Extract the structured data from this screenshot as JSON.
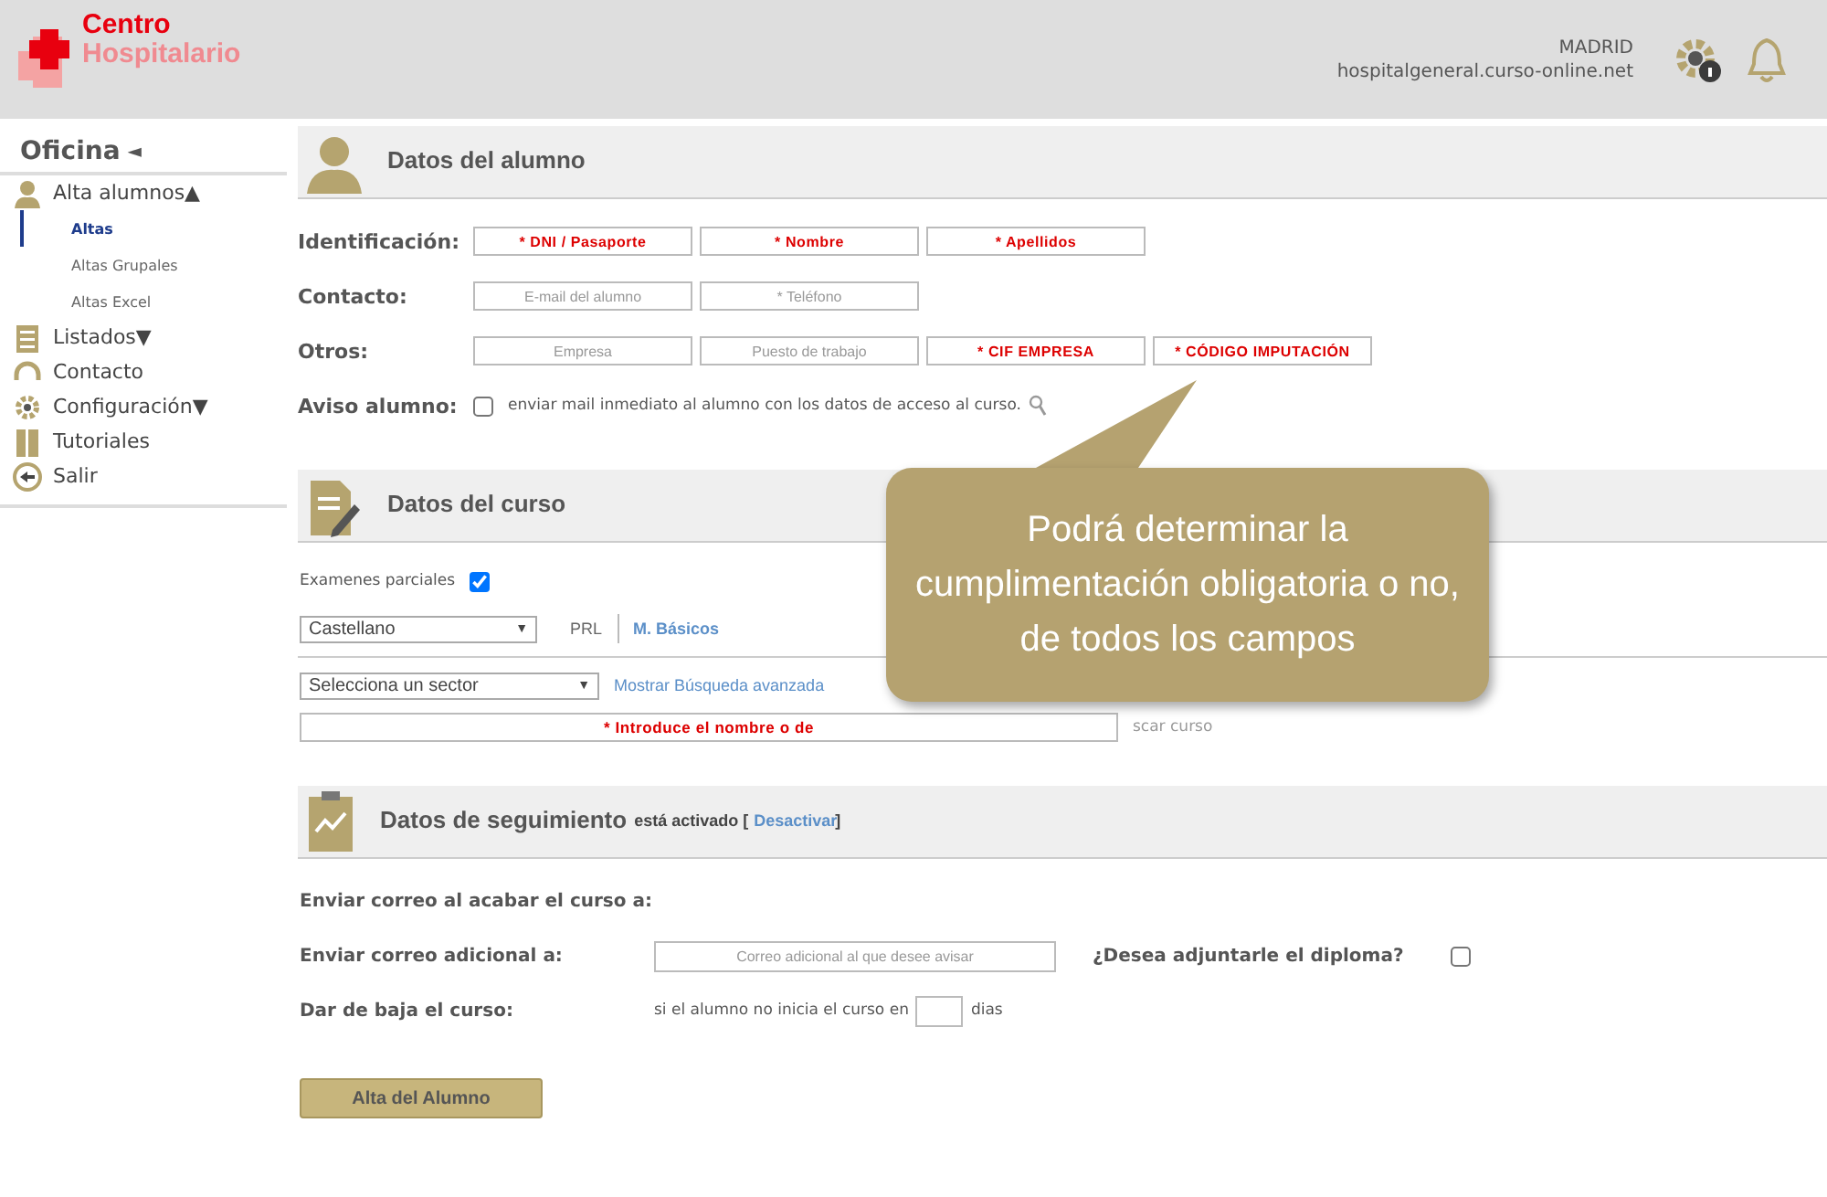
{
  "header": {
    "logo_top": "Centro",
    "logo_bottom": "Hospitalario",
    "location": "MADRID",
    "domain": "hospitalgeneral.curso-online.net"
  },
  "sidebar": {
    "title": "Oficina",
    "title_caret": "◄",
    "items": [
      {
        "label": "Alta alumnos",
        "caret": "▲",
        "children": [
          {
            "label": "Altas",
            "selected": true
          },
          {
            "label": "Altas Grupales",
            "selected": false
          },
          {
            "label": "Altas Excel",
            "selected": false
          }
        ]
      },
      {
        "label": "Listados",
        "caret": "▼"
      },
      {
        "label": "Contacto"
      },
      {
        "label": "Configuración",
        "caret": "▼"
      },
      {
        "label": "Tutoriales"
      },
      {
        "label": "Salir"
      }
    ]
  },
  "student": {
    "title": "Datos del alumno",
    "rows": [
      {
        "label": "Identificación:",
        "fields": [
          {
            "placeholder": "* DNI / Pasaporte",
            "required": true
          },
          {
            "placeholder": "* Nombre",
            "required": true
          },
          {
            "placeholder": "* Apellidos",
            "required": true
          }
        ]
      },
      {
        "label": "Contacto:",
        "fields": [
          {
            "placeholder": "E-mail del alumno",
            "required": false
          },
          {
            "placeholder": "* Teléfono",
            "required": false
          }
        ]
      },
      {
        "label": "Otros:",
        "fields": [
          {
            "placeholder": "Empresa",
            "required": false
          },
          {
            "placeholder": "Puesto de trabajo",
            "required": false
          },
          {
            "placeholder": "* CIF EMPRESA",
            "required": true
          },
          {
            "placeholder": "* CÓDIGO IMPUTACIÓN",
            "required": true
          }
        ]
      }
    ],
    "notice": {
      "label": "Aviso alumno:",
      "checked": false,
      "text": "enviar mail inmediato al alumno con los datos de acceso al curso."
    }
  },
  "course": {
    "title": "Datos del curso",
    "exams": {
      "label": "Examenes parciales",
      "checked": true
    },
    "language": "Castellano",
    "language_caret": "▼",
    "sector_caret": "▼",
    "tabs": [
      {
        "label": "PRL",
        "selected": true
      },
      {
        "label": "M. Básicos",
        "selected": false
      }
    ],
    "sector": "Selecciona un sector",
    "advanced_link": "Mostrar Búsqueda avanzada",
    "search_placeholder": "* Introduce el nombre o de",
    "search_button": "scar curso"
  },
  "tracking": {
    "title": "Datos de seguimiento",
    "status": "está activado [",
    "action": "Desactivar",
    "status_end": "]",
    "finish_label": "Enviar correo al acabar el curso a:",
    "extra_label": "Enviar correo adicional a:",
    "extra_placeholder": "Correo adicional al que desee avisar",
    "diploma_label": "¿Desea adjuntarle el diploma?",
    "diploma_checked": false,
    "drop_label": "Dar de baja el curso:",
    "drop_text": "si el alumno no inicia el curso en",
    "drop_unit": "dias"
  },
  "submit": "Alta del Alumno",
  "callout": "Podrá determinar la cumplimentación obligatoria o no, de todos los campos"
}
